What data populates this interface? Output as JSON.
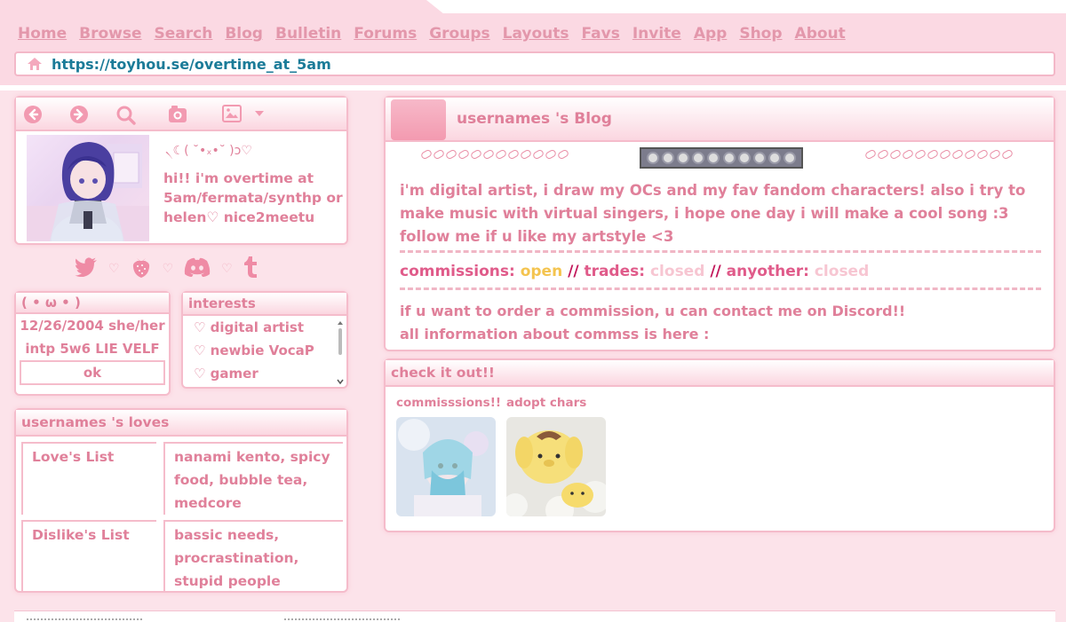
{
  "nav": {
    "items": [
      "Home",
      "Browse",
      "Search",
      "Blog",
      "Bulletin",
      "Forums",
      "Groups",
      "Layouts",
      "Favs",
      "Invite",
      "App",
      "Shop",
      "About"
    ]
  },
  "address": {
    "url": "https://toyhou.se/overtime_at_5am"
  },
  "profile": {
    "kaomoji": "৲☾( ˘•ₓ•˘ )ↄ♡",
    "bio": "hi!! i'm overtime at 5am/fermata/synthp or helen♡ nice2meetu"
  },
  "info": {
    "title": "( • ω • )",
    "line1": "12/26/2004 she/her",
    "line2": "intp 5w6 LIE VELF",
    "button": "ok"
  },
  "interests": {
    "title": "interests",
    "items": [
      "♡ digital artist",
      "♡ newbie VocaP",
      "♡ gamer"
    ]
  },
  "loves": {
    "title": "usernames 's loves",
    "rows": [
      {
        "key": "Love's List",
        "value": "nanami kento, spicy food, bubble tea, medcore"
      },
      {
        "key": "Dislike's List",
        "value": "bassic needs, procrastination, stupid people"
      }
    ]
  },
  "blog": {
    "title": "usernames 's Blog",
    "text": "i'm digital artist, i draw my OCs and my fav fandom characters! also i try to make music with virtual singers, i hope one day i will make a cool song :3 follow me if u like my artstyle <3",
    "comm_label": "commissions:",
    "comm_status": "open",
    "sep1": "//",
    "trades_label": "trades:",
    "trades_status": "closed",
    "sep2": "//",
    "any_label": "anyother:",
    "any_status": "closed",
    "foot1": "if u want to order a commission, u can contact me on Discord!!",
    "foot2": "all information about commss is here :"
  },
  "check": {
    "title": "check it out!!",
    "cards": [
      "commisssions!!",
      "adopt chars"
    ]
  },
  "colors": {
    "accent": "#e0809a",
    "band": "#fbd9e3",
    "link": "#1b7b98",
    "open": "#f4c44f"
  }
}
